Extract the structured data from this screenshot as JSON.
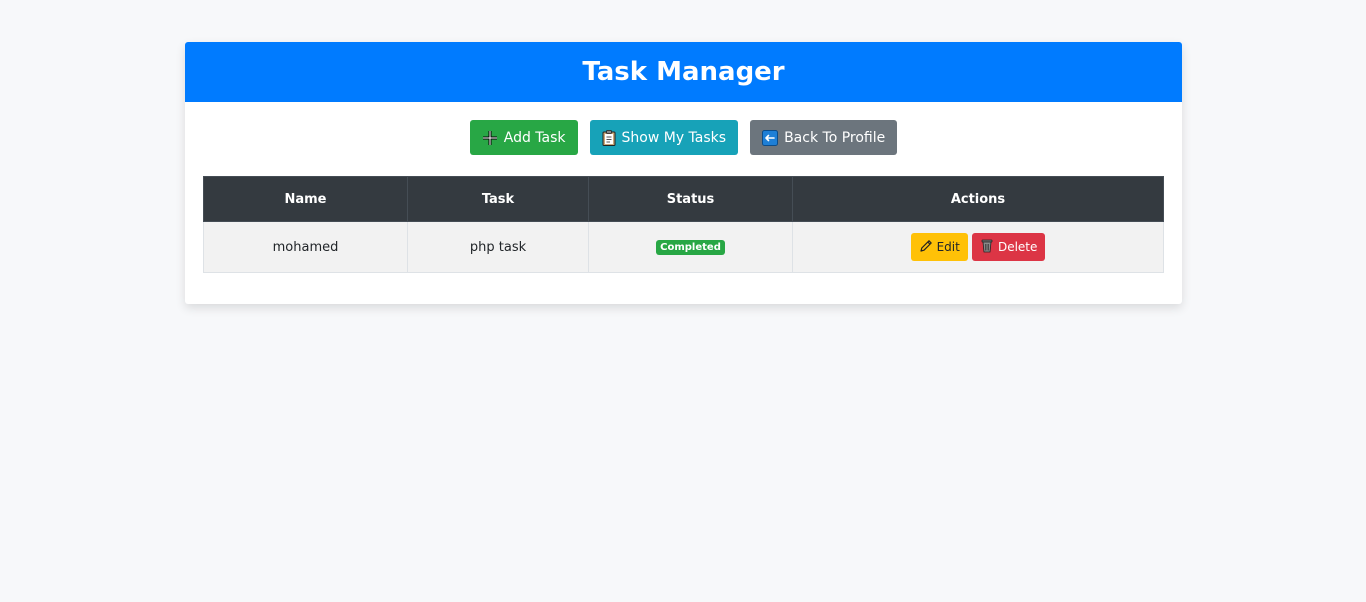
{
  "header": {
    "title": "Task Manager"
  },
  "toolbar": {
    "add_task_label": "Add Task",
    "show_tasks_label": "Show My Tasks",
    "back_profile_label": "Back To Profile"
  },
  "table": {
    "columns": [
      "Name",
      "Task",
      "Status",
      "Actions"
    ],
    "rows": [
      {
        "name": "mohamed",
        "task": "php task",
        "status": "Completed",
        "edit_label": "Edit",
        "delete_label": "Delete"
      }
    ]
  },
  "colors": {
    "primary": "#007bff",
    "success": "#28a745",
    "info": "#17a2b8",
    "secondary": "#6c757d",
    "warning": "#ffc107",
    "danger": "#dc3545",
    "dark": "#343a40"
  },
  "icons": {
    "add_task": "plus-icon",
    "show_tasks": "clipboard-icon",
    "back_profile": "left-arrow-icon",
    "edit": "pencil-icon",
    "delete": "trash-icon"
  }
}
